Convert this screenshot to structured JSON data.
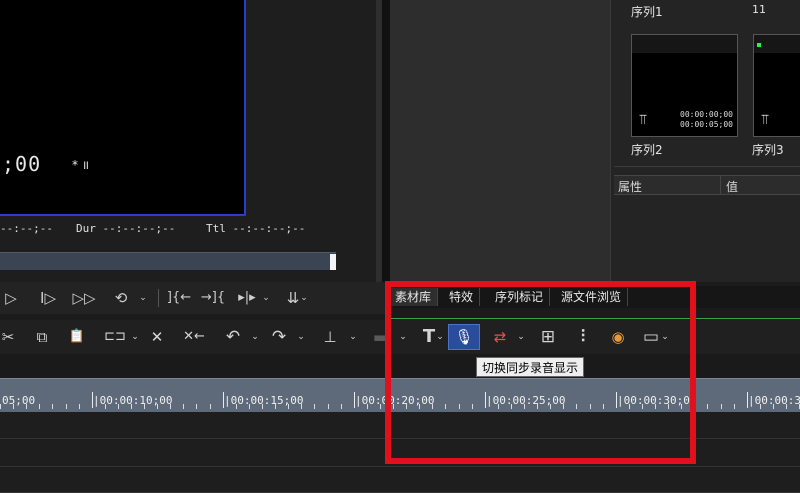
{
  "monitor": {
    "timecode": ";00",
    "timecode_mark": "* ॥",
    "in_label": "--:--;--",
    "dur_label": "Dur --:--:--;--",
    "ttl_label": "Ttl --:--:--;--"
  },
  "transport": {
    "buttons": [
      {
        "name": "play-icon",
        "glyph": "▷"
      },
      {
        "name": "next-frame-icon",
        "glyph": "I▷"
      },
      {
        "name": "fast-forward-icon",
        "glyph": "▷▷"
      },
      {
        "name": "loop-playback-icon",
        "glyph": "⟲"
      },
      {
        "name": "set-in-icon",
        "glyph": "]{←"
      },
      {
        "name": "set-out-icon",
        "glyph": "→]{"
      },
      {
        "name": "insert-icon",
        "glyph": "▸|▸"
      },
      {
        "name": "overwrite-icon",
        "glyph": "⇊"
      }
    ]
  },
  "library": {
    "sequences": [
      {
        "label": "序列1"
      },
      {
        "label": "11"
      },
      {
        "label": "序列2",
        "tc_in": "00:00:00;00",
        "tc_out": "00:00:05;00"
      },
      {
        "label": "序列3"
      }
    ],
    "properties": {
      "name_col": "属性",
      "value_col": "值"
    }
  },
  "tabs": [
    {
      "label": "素材库"
    },
    {
      "label": "特效"
    },
    {
      "label": "序列标记"
    },
    {
      "label": "源文件浏览"
    }
  ],
  "toolbar": {
    "tooltip": "切换同步录音显示",
    "dropdown_glyph": "⌄",
    "icons": {
      "cut": "✂",
      "copy": "⧉",
      "paste": "📋",
      "mode": "⊏⊐",
      "delete": "✕",
      "ripple_delete": "✕←",
      "undo": "↶",
      "redo": "↷",
      "split": "⊥",
      "camera": "▬",
      "title": "T",
      "mic": "🎙",
      "mix": "⇄",
      "grid": "⊞",
      "sliders": "⫶",
      "color": "◉",
      "window": "▭"
    }
  },
  "timeline": {
    "ruler_labels": [
      "05;00",
      "|00:00:10;00",
      "|00:00:15;00",
      "|00:00:20;00",
      "|00:00:25;00",
      "|00:00:30;00",
      "|00:00:3"
    ]
  }
}
